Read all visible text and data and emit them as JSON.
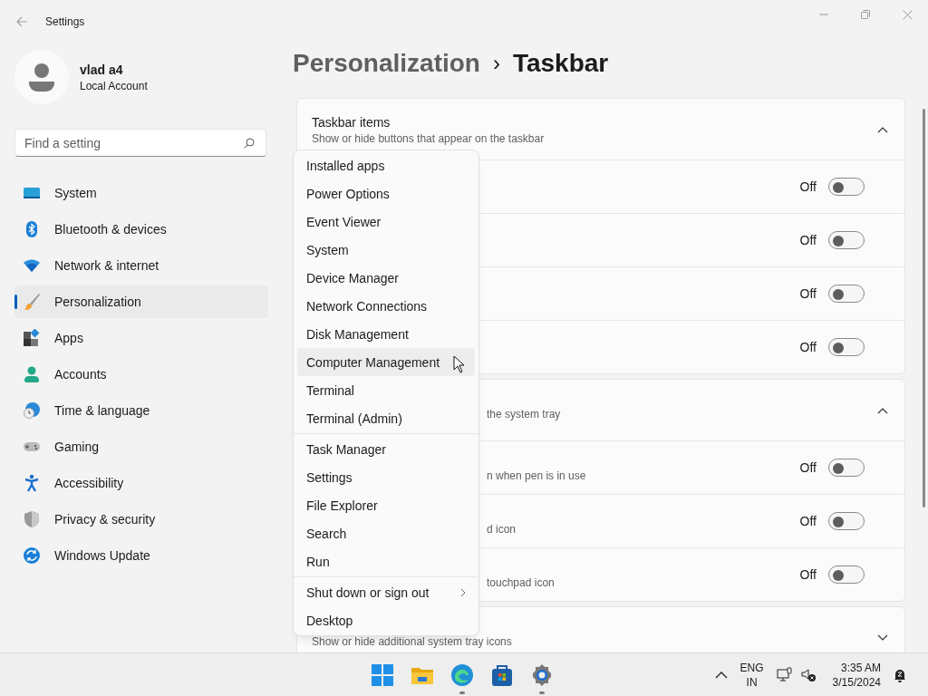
{
  "window": {
    "title": "Settings"
  },
  "account": {
    "name": "vlad a4",
    "type": "Local Account"
  },
  "search": {
    "placeholder": "Find a setting"
  },
  "nav": [
    {
      "label": "System",
      "kind": "system",
      "selected": false
    },
    {
      "label": "Bluetooth & devices",
      "kind": "bluetooth",
      "selected": false
    },
    {
      "label": "Network & internet",
      "kind": "network",
      "selected": false
    },
    {
      "label": "Personalization",
      "kind": "personalization",
      "selected": true
    },
    {
      "label": "Apps",
      "kind": "apps",
      "selected": false
    },
    {
      "label": "Accounts",
      "kind": "accounts",
      "selected": false
    },
    {
      "label": "Time & language",
      "kind": "time",
      "selected": false
    },
    {
      "label": "Gaming",
      "kind": "gaming",
      "selected": false
    },
    {
      "label": "Accessibility",
      "kind": "accessibility",
      "selected": false
    },
    {
      "label": "Privacy & security",
      "kind": "privacy",
      "selected": false
    },
    {
      "label": "Windows Update",
      "kind": "update",
      "selected": false
    }
  ],
  "breadcrumb": {
    "parent": "Personalization",
    "separator": "›",
    "current": "Taskbar"
  },
  "sections": [
    {
      "kind": "full",
      "title": "Taskbar items",
      "subtitle": "Show or hide buttons that appear on the taskbar",
      "expanded": true,
      "rows": [
        {
          "kind": "full",
          "on": false,
          "state_label": "Off"
        },
        {
          "kind": "full",
          "on": false,
          "state_label": "Off"
        },
        {
          "kind": "full",
          "on": false,
          "state_label": "Off"
        },
        {
          "kind": "full",
          "on": false,
          "state_label": "Off"
        }
      ]
    },
    {
      "kind": "covered",
      "subtitle": "the system tray",
      "expanded": true,
      "rows": [
        {
          "kind": "covered",
          "subtitle": "n when pen is in use",
          "on": false,
          "state_label": "Off"
        },
        {
          "kind": "covered",
          "subtitle": "d icon",
          "on": false,
          "state_label": "Off"
        },
        {
          "kind": "covered",
          "subtitle": "touchpad icon",
          "on": false,
          "state_label": "Off"
        }
      ]
    },
    {
      "kind": "full",
      "subtitle": "Show or hide additional system tray icons",
      "expanded": false
    }
  ],
  "context_menu": {
    "groups": [
      [
        {
          "label": "Installed apps",
          "selected": false
        },
        {
          "label": "Power Options",
          "selected": false
        },
        {
          "label": "Event Viewer",
          "selected": false
        },
        {
          "label": "System",
          "selected": false
        },
        {
          "label": "Device Manager",
          "selected": false
        },
        {
          "label": "Network Connections",
          "selected": false
        },
        {
          "label": "Disk Management",
          "selected": false
        },
        {
          "label": "Computer Management",
          "selected": true
        },
        {
          "label": "Terminal",
          "selected": false
        },
        {
          "label": "Terminal (Admin)",
          "selected": false
        }
      ],
      [
        {
          "label": "Task Manager",
          "selected": false
        },
        {
          "label": "Settings",
          "selected": false
        },
        {
          "label": "File Explorer",
          "selected": false
        },
        {
          "label": "Search",
          "selected": false
        },
        {
          "label": "Run",
          "selected": false
        }
      ],
      [
        {
          "label": "Shut down or sign out",
          "selected": false,
          "submenu": true
        },
        {
          "label": "Desktop",
          "selected": false
        }
      ]
    ]
  },
  "taskbar": {
    "apps": [
      {
        "kind": "start",
        "running": false
      },
      {
        "kind": "explorer",
        "running": false
      },
      {
        "kind": "edge",
        "running": true
      },
      {
        "kind": "store",
        "running": false
      },
      {
        "kind": "settings",
        "running": true
      }
    ],
    "language": "ENG",
    "region": "IN",
    "time": "3:35 AM",
    "date": "3/15/2024"
  }
}
